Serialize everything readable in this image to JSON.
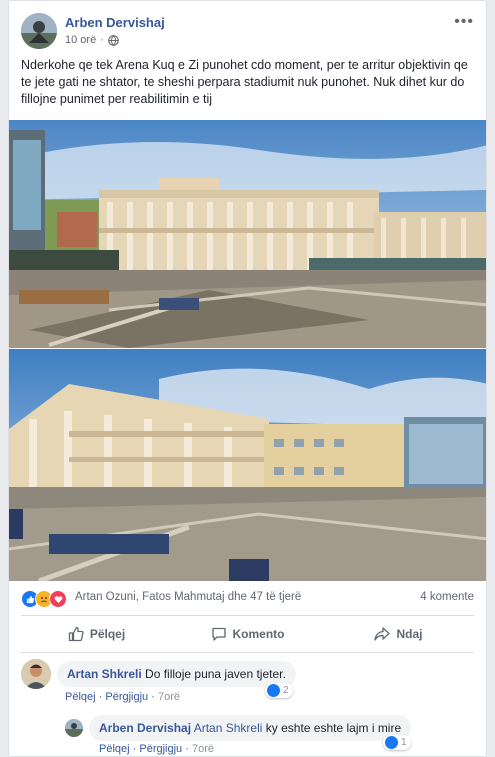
{
  "post": {
    "author": "Arben Dervishaj",
    "time": "10 orë",
    "privacy_icon": "globe-icon",
    "more_icon": "more-options-icon",
    "text": "Nderkohe qe tek Arena Kuq e Zi punohet cdo moment, per te arritur objektivin qe te jete gati ne shtator, te sheshi perpara stadiumit nuk punohet. Nuk dihet kur do fillojne punimet per reabilitimin e tij"
  },
  "reactions": {
    "icons": [
      "like-icon",
      "sad-icon",
      "love-icon"
    ],
    "names": "Artan Ozuni, Fatos Mahmutaj dhe 47 të tjerë",
    "comments_count": "4 komente"
  },
  "actions": {
    "like": "Pëlqej",
    "comment": "Komento",
    "share": "Ndaj"
  },
  "comments": [
    {
      "author": "Artan Shkreli",
      "text": "Do filloje puna javen tjeter.",
      "like_label": "Pëlqej",
      "reply_label": "Përgjigju",
      "time": "7orë",
      "likes": "2"
    },
    {
      "author": "Arben Dervishaj",
      "mention": "Artan Shkreli",
      "text": "ky eshte eshte lajm i mire",
      "like_label": "Pëlqej",
      "reply_label": "Përgjigju",
      "time": "7orë",
      "likes": "1"
    }
  ],
  "colors": {
    "link": "#385898",
    "like_blue": "#1877f2",
    "sad_yellow": "#f7b125",
    "love_red": "#f33e58"
  }
}
